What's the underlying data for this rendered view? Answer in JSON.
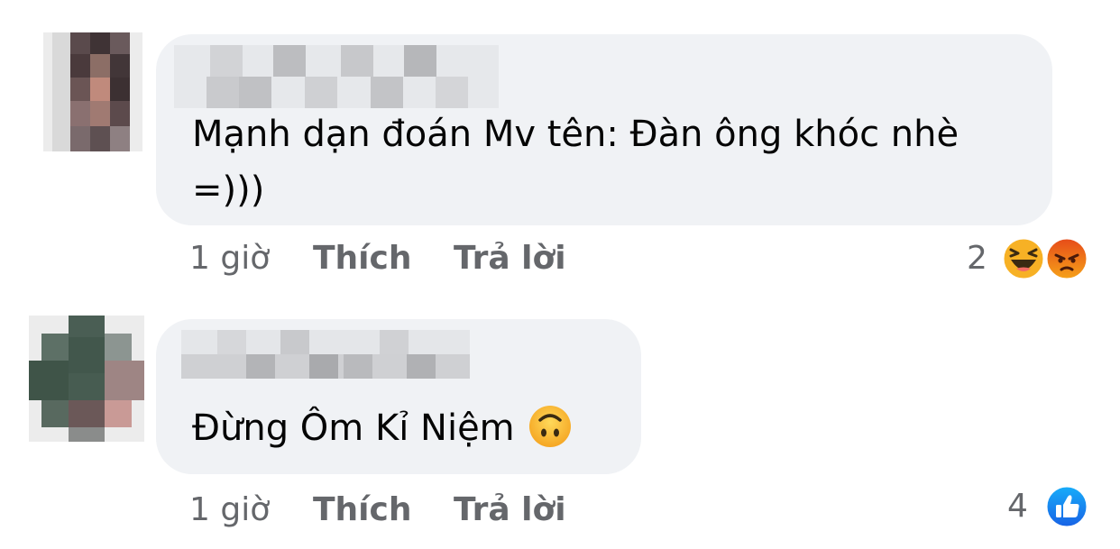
{
  "comments": [
    {
      "text": "Mạnh dạn đoán Mv tên: Đàn ông khóc nhè =)))",
      "time": "1 giờ",
      "like_label": "Thích",
      "reply_label": "Trả lời",
      "reaction_count": "2",
      "reactions": [
        "haha-icon",
        "angry-icon"
      ]
    },
    {
      "text": "Đừng Ôm Kỉ Niệm",
      "inline_emoji": "upside-down-face-icon",
      "time": "1 giờ",
      "like_label": "Thích",
      "reply_label": "Trả lời",
      "reaction_count": "4",
      "reactions": [
        "like-icon"
      ]
    }
  ],
  "colors": {
    "bubble": "#f0f2f5",
    "meta_text": "#65676b",
    "like_blue": "#1877f2",
    "haha_yellow": "#f7b125",
    "angry_orange": "#e9710f"
  }
}
